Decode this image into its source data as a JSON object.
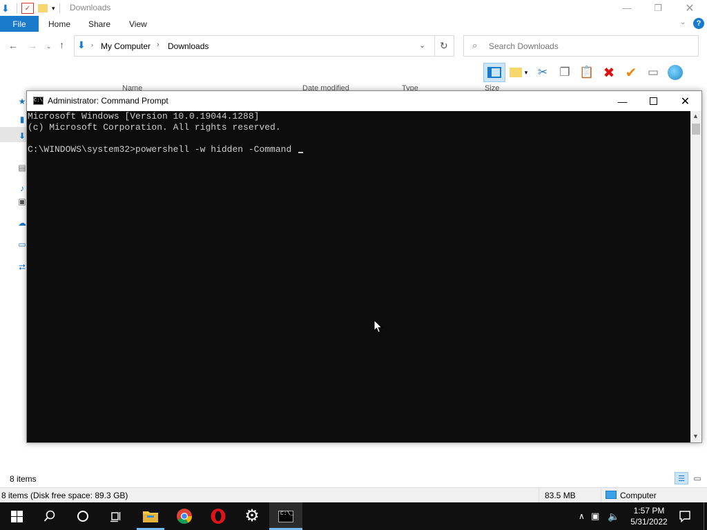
{
  "explorer": {
    "title": "Downloads",
    "tabs": {
      "file": "File",
      "home": "Home",
      "share": "Share",
      "view": "View"
    },
    "breadcrumb": {
      "root": "My Computer",
      "current": "Downloads"
    },
    "search_placeholder": "Search Downloads",
    "columns": {
      "name": "Name",
      "date": "Date modified",
      "type": "Type",
      "size": "Size"
    },
    "status": {
      "items": "8 items"
    },
    "details_bar": {
      "summary": "8 items (Disk free space: 89.3 GB)",
      "size": "83.5 MB",
      "location": "Computer"
    }
  },
  "cmd": {
    "title": "Administrator: Command Prompt",
    "lines": [
      "Microsoft Windows [Version 10.0.19044.1288]",
      "(c) Microsoft Corporation. All rights reserved.",
      "",
      "C:\\WINDOWS\\system32>powershell -w hidden -Command "
    ],
    "background": "#0c0c0c",
    "foreground": "#cccccc"
  },
  "taskbar": {
    "time": "1:57 PM",
    "date": "5/31/2022",
    "icons": [
      "windows-start-icon",
      "search-icon",
      "cortana-icon",
      "task-view-icon",
      "file-explorer-icon",
      "chrome-icon",
      "opera-icon",
      "settings-icon",
      "cmd-icon"
    ]
  },
  "colors": {
    "accent": "#1979ca",
    "taskbar": "#101010",
    "opera_red": "#e1141c"
  }
}
